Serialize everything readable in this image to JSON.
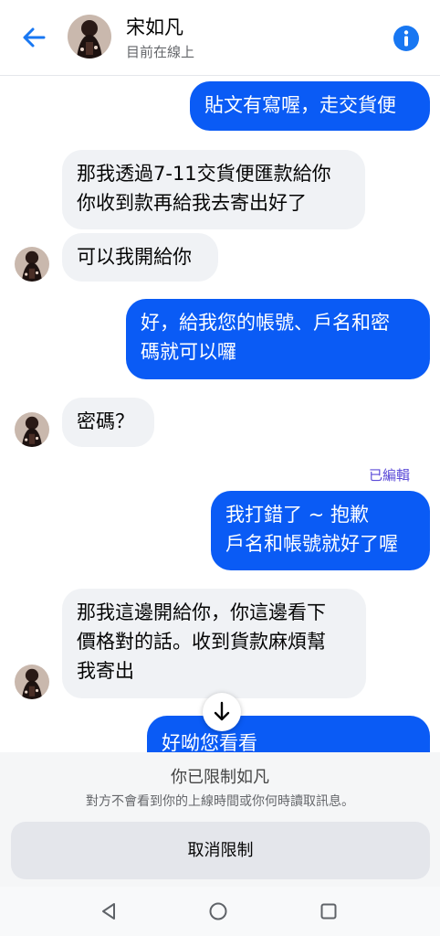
{
  "header": {
    "name": "宋如凡",
    "status": "目前在線上",
    "back_icon": "arrow-left-icon",
    "info_icon": "info-icon"
  },
  "messages": [
    {
      "side": "out",
      "text": "貼文有寫喔，走交貨便"
    },
    {
      "side": "in",
      "lines": [
        "那我透過7-11交貨便匯款給你",
        "你收到款再給我去寄出好了"
      ]
    },
    {
      "side": "in",
      "text": "可以我開給你"
    },
    {
      "side": "out",
      "lines": [
        "好，給我您的帳號、戶名和密",
        "碼就可以囉"
      ]
    },
    {
      "side": "in",
      "text": "密碼？"
    },
    {
      "side": "out",
      "edited": "已編輯",
      "lines": [
        "我打錯了 ~ 抱歉",
        "戶名和帳號就好了喔"
      ]
    },
    {
      "side": "in",
      "lines": [
        "那我這邊開給你，你這邊看下",
        "價格對的話。收到貨款麻煩幫",
        "我寄出"
      ]
    },
    {
      "side": "out",
      "text": "好呦您看看"
    }
  ],
  "scroll_down_icon": "arrow-down-icon",
  "restricted": {
    "title": "你已限制如凡",
    "description": "對方不會看到你的上線時間或你何時讀取訊息。",
    "button": "取消限制"
  },
  "colors": {
    "accent": "#1877f2",
    "outgoing_bubble": "#0a5bf5",
    "incoming_bubble": "#f0f2f5",
    "edited_label": "#5b4bd8"
  },
  "navigation": {
    "back_icon": "triangle-back-icon",
    "home_icon": "circle-home-icon",
    "recents_icon": "square-recents-icon"
  }
}
